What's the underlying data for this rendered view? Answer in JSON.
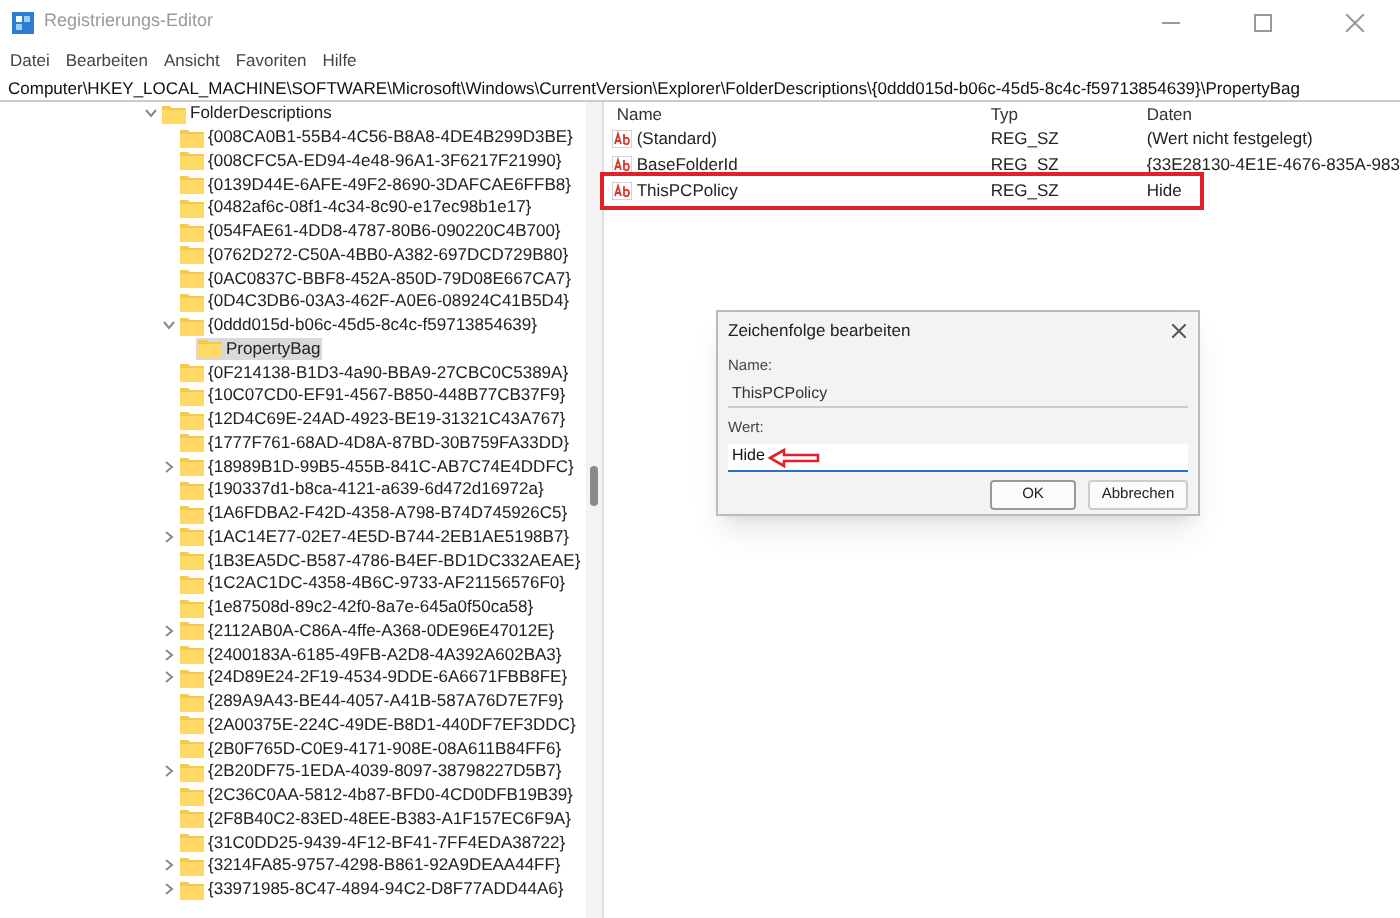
{
  "window": {
    "title": "Registrierungs-Editor",
    "active": false
  },
  "menu": [
    "Datei",
    "Bearbeiten",
    "Ansicht",
    "Favoriten",
    "Hilfe"
  ],
  "address": "Computer\\HKEY_LOCAL_MACHINE\\SOFTWARE\\Microsoft\\Windows\\CurrentVersion\\Explorer\\FolderDescriptions\\{0ddd015d-b06c-45d5-8c4c-f59713854639}\\PropertyBag",
  "tree": [
    {
      "label": "FolderDescriptions",
      "kind": "branch",
      "expanded": true,
      "selected": false,
      "children": [
        {
          "label": "{008CA0B1-55B4-4C56-B8A8-4DE4B299D3BE}",
          "kind": "leaf",
          "selected": false
        },
        {
          "label": "{008CFC5A-ED94-4e48-96A1-3F6217F21990}",
          "kind": "leaf",
          "selected": false
        },
        {
          "label": "{0139D44E-6AFE-49F2-8690-3DAFCAE6FFB8}",
          "kind": "leaf",
          "selected": false
        },
        {
          "label": "{0482af6c-08f1-4c34-8c90-e17ec98b1e17}",
          "kind": "leaf",
          "selected": false
        },
        {
          "label": "{054FAE61-4DD8-4787-80B6-090220C4B700}",
          "kind": "leaf",
          "selected": false
        },
        {
          "label": "{0762D272-C50A-4BB0-A382-697DCD729B80}",
          "kind": "leaf",
          "selected": false
        },
        {
          "label": "{0AC0837C-BBF8-452A-850D-79D08E667CA7}",
          "kind": "leaf",
          "selected": false
        },
        {
          "label": "{0D4C3DB6-03A3-462F-A0E6-08924C41B5D4}",
          "kind": "leaf",
          "selected": false
        },
        {
          "label": "{0ddd015d-b06c-45d5-8c4c-f59713854639}",
          "kind": "branch",
          "expanded": true,
          "selected": false,
          "children": [
            {
              "label": "PropertyBag",
              "kind": "leaf",
              "selected": true
            }
          ]
        },
        {
          "label": "{0F214138-B1D3-4a90-BBA9-27CBC0C5389A}",
          "kind": "leaf",
          "selected": false
        },
        {
          "label": "{10C07CD0-EF91-4567-B850-448B77CB37F9}",
          "kind": "leaf",
          "selected": false
        },
        {
          "label": "{12D4C69E-24AD-4923-BE19-31321C43A767}",
          "kind": "leaf",
          "selected": false
        },
        {
          "label": "{1777F761-68AD-4D8A-87BD-30B759FA33DD}",
          "kind": "leaf",
          "selected": false
        },
        {
          "label": "{18989B1D-99B5-455B-841C-AB7C74E4DDFC}",
          "kind": "branch",
          "expanded": false,
          "selected": false
        },
        {
          "label": "{190337d1-b8ca-4121-a639-6d472d16972a}",
          "kind": "leaf",
          "selected": false
        },
        {
          "label": "{1A6FDBA2-F42D-4358-A798-B74D745926C5}",
          "kind": "leaf",
          "selected": false
        },
        {
          "label": "{1AC14E77-02E7-4E5D-B744-2EB1AE5198B7}",
          "kind": "branch",
          "expanded": false,
          "selected": false
        },
        {
          "label": "{1B3EA5DC-B587-4786-B4EF-BD1DC332AEAE}",
          "kind": "leaf",
          "selected": false
        },
        {
          "label": "{1C2AC1DC-4358-4B6C-9733-AF21156576F0}",
          "kind": "leaf",
          "selected": false
        },
        {
          "label": "{1e87508d-89c2-42f0-8a7e-645a0f50ca58}",
          "kind": "leaf",
          "selected": false
        },
        {
          "label": "{2112AB0A-C86A-4ffe-A368-0DE96E47012E}",
          "kind": "branch",
          "expanded": false,
          "selected": false
        },
        {
          "label": "{2400183A-6185-49FB-A2D8-4A392A602BA3}",
          "kind": "branch",
          "expanded": false,
          "selected": false
        },
        {
          "label": "{24D89E24-2F19-4534-9DDE-6A6671FBB8FE}",
          "kind": "branch",
          "expanded": false,
          "selected": false
        },
        {
          "label": "{289A9A43-BE44-4057-A41B-587A76D7E7F9}",
          "kind": "leaf",
          "selected": false
        },
        {
          "label": "{2A00375E-224C-49DE-B8D1-440DF7EF3DDC}",
          "kind": "leaf",
          "selected": false
        },
        {
          "label": "{2B0F765D-C0E9-4171-908E-08A611B84FF6}",
          "kind": "leaf",
          "selected": false
        },
        {
          "label": "{2B20DF75-1EDA-4039-8097-38798227D5B7}",
          "kind": "branch",
          "expanded": false,
          "selected": false
        },
        {
          "label": "{2C36C0AA-5812-4b87-BFD0-4CD0DFB19B39}",
          "kind": "leaf",
          "selected": false
        },
        {
          "label": "{2F8B40C2-83ED-48EE-B383-A1F157EC6F9A}",
          "kind": "leaf",
          "selected": false
        },
        {
          "label": "{31C0DD25-9439-4F12-BF41-7FF4EDA38722}",
          "kind": "leaf",
          "selected": false
        },
        {
          "label": "{3214FA85-9757-4298-B861-92A9DEAA44FF}",
          "kind": "branch",
          "expanded": false,
          "selected": false
        },
        {
          "label": "{33971985-8C47-4894-94C2-D8F77ADD44A6}",
          "kind": "branch",
          "expanded": false,
          "selected": false
        }
      ]
    }
  ],
  "columns": [
    "Name",
    "Typ",
    "Daten"
  ],
  "values": [
    {
      "name": "(Standard)",
      "type": "REG_SZ",
      "data": "(Wert nicht festgelegt)",
      "highlighted": false
    },
    {
      "name": "BaseFolderId",
      "type": "REG_SZ",
      "data": "{33E28130-4E1E-4676-835A-983",
      "highlighted": false
    },
    {
      "name": "ThisPCPolicy",
      "type": "REG_SZ",
      "data": "Hide",
      "highlighted": true
    }
  ],
  "dialog": {
    "title": "Zeichenfolge bearbeiten",
    "name_label": "Name:",
    "name_value": "ThisPCPolicy",
    "value_label": "Wert:",
    "value": "Hide",
    "arrow": true,
    "buttons": [
      "OK",
      "Abbrechen"
    ]
  }
}
